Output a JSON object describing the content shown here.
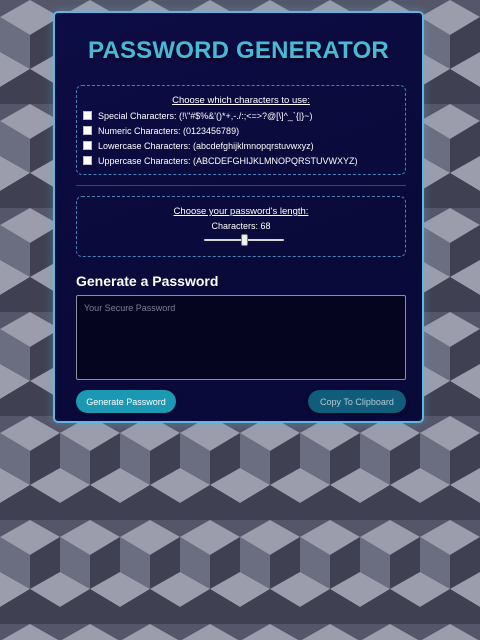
{
  "colors": {
    "card_border": "#5eb6e2",
    "title": "#48b9d6",
    "card_background": "#0b0b40",
    "generate_button": "#1a98b4",
    "copy_button": "#0f5d7a",
    "background_pattern": [
      "#9b9dad",
      "#6b6d80",
      "#3f4152"
    ]
  },
  "title": "PASSWORD GENERATOR",
  "characters": {
    "heading": "Choose which characters to use:",
    "options": [
      {
        "label": "Special Characters: (!\\\"#$%&'()*+,-./:;<=>?@[\\]^_`{|}~)",
        "checked": false
      },
      {
        "label": "Numeric Characters: (0123456789)",
        "checked": false
      },
      {
        "label": "Lowercase Characters: (abcdefghijklmnopqrstuvwxyz)",
        "checked": false
      },
      {
        "label": "Uppercase Characters: (ABCDEFGHIJKLMNOPQRSTUVWXYZ)",
        "checked": false
      }
    ]
  },
  "length": {
    "heading": "Choose your password's length:",
    "label": "Characters: 68",
    "value": 68,
    "slider_fraction": 0.5
  },
  "generate": {
    "heading": "Generate a Password",
    "placeholder": "Your Secure Password",
    "value": ""
  },
  "buttons": {
    "generate_label": "Generate Password",
    "copy_label": "Copy To Clipboard"
  }
}
